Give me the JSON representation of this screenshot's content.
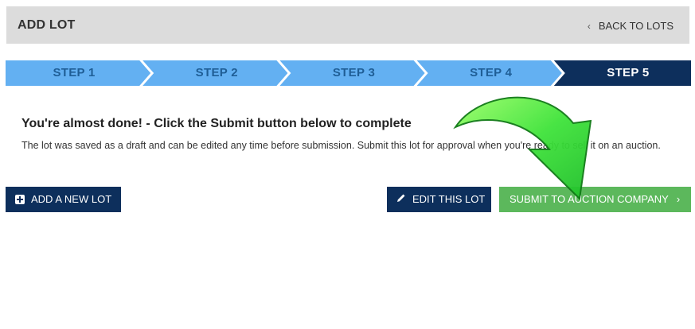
{
  "header": {
    "title": "ADD LOT",
    "back_label": "BACK TO LOTS",
    "back_icon": "chevron-left-icon"
  },
  "steps": [
    {
      "label": "STEP 1",
      "state": "inactive"
    },
    {
      "label": "STEP 2",
      "state": "inactive"
    },
    {
      "label": "STEP 3",
      "state": "inactive"
    },
    {
      "label": "STEP 4",
      "state": "inactive"
    },
    {
      "label": "STEP 5",
      "state": "active"
    }
  ],
  "colors": {
    "step_inactive": "#63b0f2",
    "step_active": "#0d2f5c",
    "submit": "#5cb85c",
    "dark_button": "#0d2f5c",
    "header_bg": "#dcdcdc"
  },
  "message": {
    "title": "You're almost done! - Click the Submit button below to complete",
    "body": "The lot was saved as a draft and can be edited any time before submission. Submit this lot for approval when you're ready to sell it on an auction."
  },
  "buttons": {
    "add_new_lot": "ADD A NEW LOT",
    "edit_lot": "EDIT THIS LOT",
    "submit": "SUBMIT TO AUCTION COMPANY"
  }
}
